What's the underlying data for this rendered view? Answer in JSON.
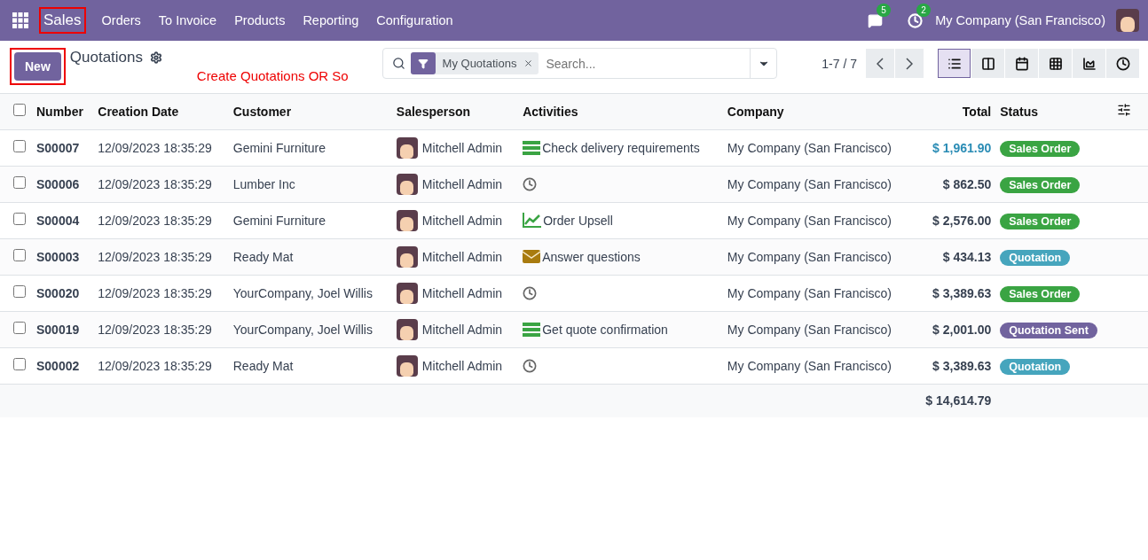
{
  "navbar": {
    "app": {
      "label": "Sales",
      "outlined": true
    },
    "menu": [
      "Orders",
      "To Invoice",
      "Products",
      "Reporting",
      "Configuration"
    ],
    "messages_count": "5",
    "activities_count": "2",
    "company": "My Company (San Francisco)"
  },
  "control_panel": {
    "new_button": {
      "label": "New",
      "outlined": true
    },
    "title": "Quotations",
    "annotation": "Create Quotations OR So",
    "search": {
      "facet": "My Quotations",
      "placeholder": "Search..."
    },
    "pager": "1-7 / 7",
    "views": [
      {
        "kind": "list",
        "selected": true
      },
      {
        "kind": "kanban",
        "selected": false
      },
      {
        "kind": "calendar",
        "selected": false
      },
      {
        "kind": "pivot",
        "selected": false
      },
      {
        "kind": "graph",
        "selected": false
      },
      {
        "kind": "activity",
        "selected": false
      }
    ]
  },
  "table": {
    "all_selected": false,
    "columns": [
      "Number",
      "Creation Date",
      "Customer",
      "Salesperson",
      "Activities",
      "Company",
      "Total",
      "Status"
    ],
    "rows": [
      {
        "number": "S00007",
        "date": "12/09/2023 18:35:29",
        "customer": "Gemini Furniture",
        "salesperson": "Mitchell Admin",
        "activity": {
          "kind": "todo",
          "label": "Check delivery requirements"
        },
        "company": "My Company (San Francisco)",
        "total": "$ 1,961.90",
        "highlighted": true,
        "status": {
          "label": "Sales Order",
          "color": "#3aa443"
        },
        "checked": false
      },
      {
        "number": "S00006",
        "date": "12/09/2023 18:35:29",
        "customer": "Lumber Inc",
        "salesperson": "Mitchell Admin",
        "activity": {
          "kind": "clock"
        },
        "company": "My Company (San Francisco)",
        "total": "$ 862.50",
        "highlighted": false,
        "status": {
          "label": "Sales Order",
          "color": "#3aa443"
        },
        "checked": false
      },
      {
        "number": "S00004",
        "date": "12/09/2023 18:35:29",
        "customer": "Gemini Furniture",
        "salesperson": "Mitchell Admin",
        "activity": {
          "kind": "upsell",
          "label": "Order Upsell"
        },
        "company": "My Company (San Francisco)",
        "total": "$ 2,576.00",
        "highlighted": false,
        "status": {
          "label": "Sales Order",
          "color": "#3aa443"
        },
        "checked": false
      },
      {
        "number": "S00003",
        "date": "12/09/2023 18:35:29",
        "customer": "Ready Mat",
        "salesperson": "Mitchell Admin",
        "activity": {
          "kind": "email",
          "label": "Answer questions"
        },
        "company": "My Company (San Francisco)",
        "total": "$ 434.13",
        "highlighted": false,
        "status": {
          "label": "Quotation",
          "color": "#46a5bd"
        },
        "checked": false
      },
      {
        "number": "S00020",
        "date": "12/09/2023 18:35:29",
        "customer": "YourCompany, Joel Willis",
        "salesperson": "Mitchell Admin",
        "activity": {
          "kind": "clock"
        },
        "company": "My Company (San Francisco)",
        "total": "$ 3,389.63",
        "highlighted": false,
        "status": {
          "label": "Sales Order",
          "color": "#3aa443"
        },
        "checked": false
      },
      {
        "number": "S00019",
        "date": "12/09/2023 18:35:29",
        "customer": "YourCompany, Joel Willis",
        "salesperson": "Mitchell Admin",
        "activity": {
          "kind": "todo",
          "label": "Get quote confirmation"
        },
        "company": "My Company (San Francisco)",
        "total": "$ 2,001.00",
        "highlighted": false,
        "status": {
          "label": "Quotation Sent",
          "color": "#71639e"
        },
        "checked": false
      },
      {
        "number": "S00002",
        "date": "12/09/2023 18:35:29",
        "customer": "Ready Mat",
        "salesperson": "Mitchell Admin",
        "activity": {
          "kind": "clock"
        },
        "company": "My Company (San Francisco)",
        "total": "$ 3,389.63",
        "highlighted": false,
        "status": {
          "label": "Quotation",
          "color": "#46a5bd"
        },
        "checked": false
      }
    ],
    "grand_total": "$ 14,614.79"
  }
}
